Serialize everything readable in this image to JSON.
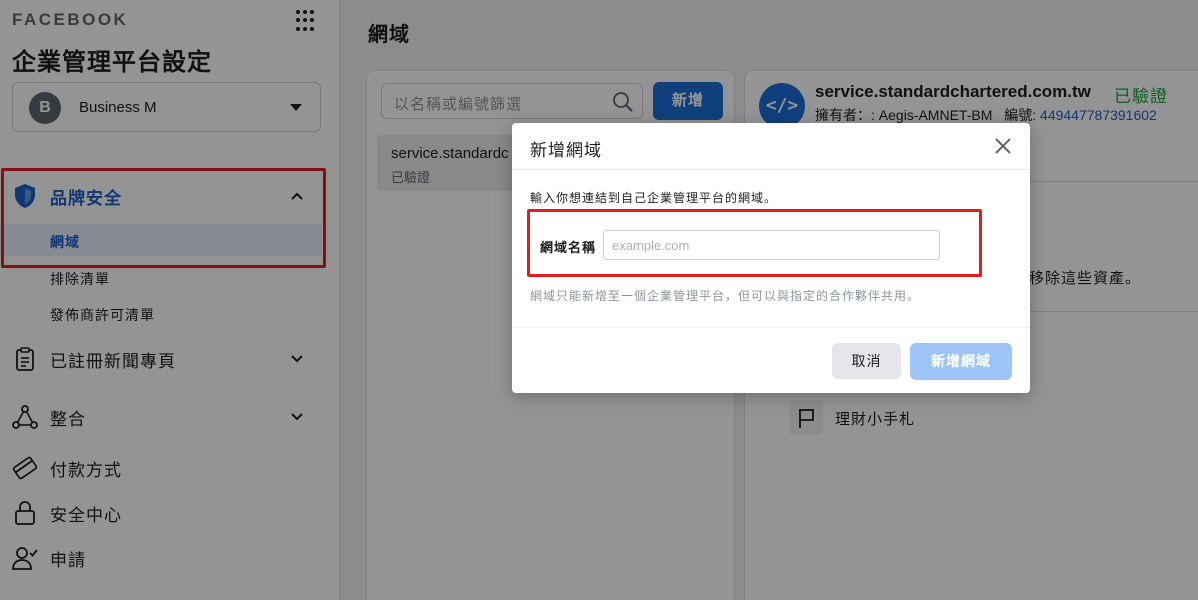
{
  "sidebar": {
    "brand": "FACEBOOK",
    "title": "企業管理平台設定",
    "business": {
      "avatar_letter": "B",
      "name": "Business M"
    },
    "sections": {
      "brand_safety": {
        "label": "品牌安全",
        "items": [
          {
            "label": "網域",
            "active": true
          },
          {
            "label": "排除清單"
          },
          {
            "label": "發佈商許可清單"
          }
        ]
      },
      "registered_news": {
        "label": "已註冊新聞專頁"
      },
      "integrations": {
        "label": "整合"
      },
      "payments": {
        "label": "付款方式"
      },
      "security_center": {
        "label": "安全中心"
      },
      "requests": {
        "label": "申請"
      }
    }
  },
  "main": {
    "title": "網域",
    "filter": {
      "placeholder": "以名稱或編號篩選"
    },
    "add_button": "新增",
    "list": [
      {
        "name": "service.standardc",
        "status": "已驗證"
      }
    ],
    "detail": {
      "badge": "</>",
      "domain": "service.standardchartered.com.tw",
      "verified": "已驗證",
      "owner_label": "擁有者：: Aegis-AMNET-BM",
      "id_label": "編號:",
      "id_value": "449447787391602",
      "remove_text": "移除這些資產。",
      "asset_name": "理財小手札"
    }
  },
  "modal": {
    "title": "新增網域",
    "description": "輸入你想連結到自己企業管理平台的網域。",
    "field_label": "網域名稱",
    "field_placeholder": "example.com",
    "hint": "網域只能新增至一個企業管理平台，但可以與指定的合作夥伴共用。",
    "cancel": "取消",
    "submit": "新增網域"
  },
  "colors": {
    "accent": "#1b6fd8",
    "active_text": "#1b5fc9",
    "verified": "#20a33d",
    "highlight": "#e01e1e"
  }
}
